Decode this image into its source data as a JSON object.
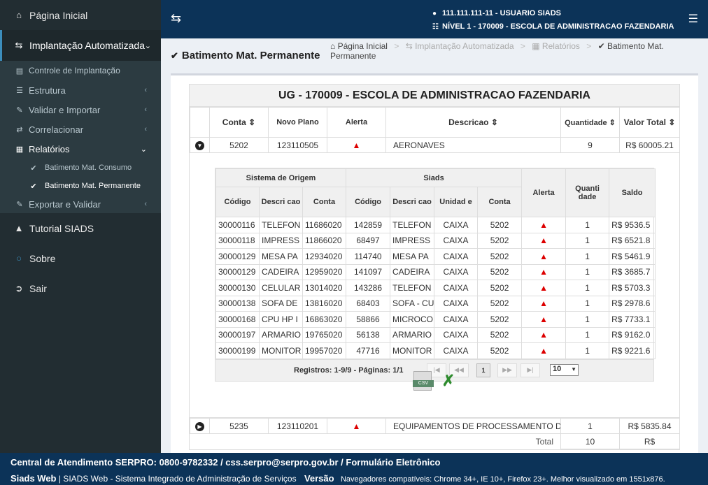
{
  "sidebar": {
    "home": "Página Inicial",
    "implantacao": "Implantação Automatizada",
    "sub": [
      {
        "label": "Controle de Implantação"
      },
      {
        "label": "Estrutura"
      },
      {
        "label": "Validar e Importar"
      },
      {
        "label": "Correlacionar"
      },
      {
        "label": "Relatórios"
      }
    ],
    "reports": [
      "Batimento Mat. Consumo",
      "Batimento Mat. Permanente"
    ],
    "exportar": "Exportar e Validar",
    "tutorial": "Tutorial SIADS",
    "sobre": "Sobre",
    "sair": "Sair"
  },
  "header": {
    "user": "111.111.111-11 - USUARIO SIADS",
    "level": "NÍVEL 1 - 170009 - ESCOLA DE ADMINISTRACAO FAZENDARIA"
  },
  "page": {
    "title": "Batimento Mat. Permanente",
    "breadcrumb": [
      "Página Inicial",
      "Implantação Automatizada",
      "Relatórios",
      "Batimento Mat. Permanente"
    ]
  },
  "report": {
    "ug_title": "UG - 170009 - ESCOLA DE ADMINISTRACAO FAZENDARIA",
    "columns": {
      "conta": "Conta",
      "novo_plano": "Novo Plano",
      "alerta": "Alerta",
      "descricao": "Descricao",
      "quantidade": "Quantidade",
      "valor_total": "Valor Total"
    },
    "row1": {
      "conta": "5202",
      "novo_plano": "123110505",
      "descricao": "AERONAVES",
      "quantidade": "9",
      "valor": "R$ 60005.21"
    },
    "row2": {
      "conta": "5235",
      "novo_plano": "123110201",
      "descricao": "EQUIPAMENTOS DE PROCESSAMENTO D",
      "quantidade": "1",
      "valor": "R$ 5835.84"
    },
    "total_label": "Total",
    "total_qty": "10",
    "total_val": "R$"
  },
  "detail": {
    "group_origem": "Sistema de Origem",
    "group_siads": "Siads",
    "h_codigo": "Código",
    "h_descricao": "Descri cao",
    "h_conta": "Conta",
    "h_unidade": "Unidad e",
    "h_alerta": "Alerta",
    "h_quantidade": "Quanti dade",
    "h_saldo": "Saldo",
    "rows": [
      [
        "30000116",
        "TELEFON",
        "11686020",
        "142859",
        "TELEFON",
        "CAIXA",
        "5202",
        "1",
        "R$ 9536.5"
      ],
      [
        "30000118",
        "IMPRESS",
        "11866020",
        "68497",
        "IMPRESS",
        "CAIXA",
        "5202",
        "1",
        "R$ 6521.8"
      ],
      [
        "30000129",
        "MESA PA",
        "12934020",
        "114740",
        "MESA PA",
        "CAIXA",
        "5202",
        "1",
        "R$ 5461.9"
      ],
      [
        "30000129",
        "CADEIRA",
        "12959020",
        "141097",
        "CADEIRA",
        "CAIXA",
        "5202",
        "1",
        "R$ 3685.7"
      ],
      [
        "30000130",
        "CELULAR",
        "13014020",
        "143286",
        "TELEFON",
        "CAIXA",
        "5202",
        "1",
        "R$ 5703.3"
      ],
      [
        "30000138",
        "SOFA DE",
        "13816020",
        "68403",
        "SOFA - CU",
        "CAIXA",
        "5202",
        "1",
        "R$ 2978.6"
      ],
      [
        "30000168",
        "CPU HP I",
        "16863020",
        "58866",
        "MICROCO",
        "CAIXA",
        "5202",
        "1",
        "R$ 7733.1"
      ],
      [
        "30000197",
        "ARMARIO",
        "19765020",
        "56138",
        "ARMARIO",
        "CAIXA",
        "5202",
        "1",
        "R$ 9162.0"
      ],
      [
        "30000199",
        "MONITOR",
        "19957020",
        "47716",
        "MONITOR",
        "CAIXA",
        "5202",
        "1",
        "R$ 9221.6"
      ]
    ],
    "pager_text": "Registros: 1-9/9 - Páginas: 1/1",
    "current_page": "1",
    "rows_per_page": "10",
    "csv_label": "CSV"
  },
  "footer": {
    "central": "Central de Atendimento SERPRO: 0800-9782332 / css.serpro@serpro.gov.br / Formulário Eletrônico",
    "brand": "Siads Web",
    "desc": "| SIADS Web - Sistema Integrado de Administração de Serviços",
    "versao": "Versão",
    "browsers": "Navegadores compatíveis: Chrome 34+, IE 10+, Firefox 23+. Melhor visualizado em 1551x876."
  }
}
